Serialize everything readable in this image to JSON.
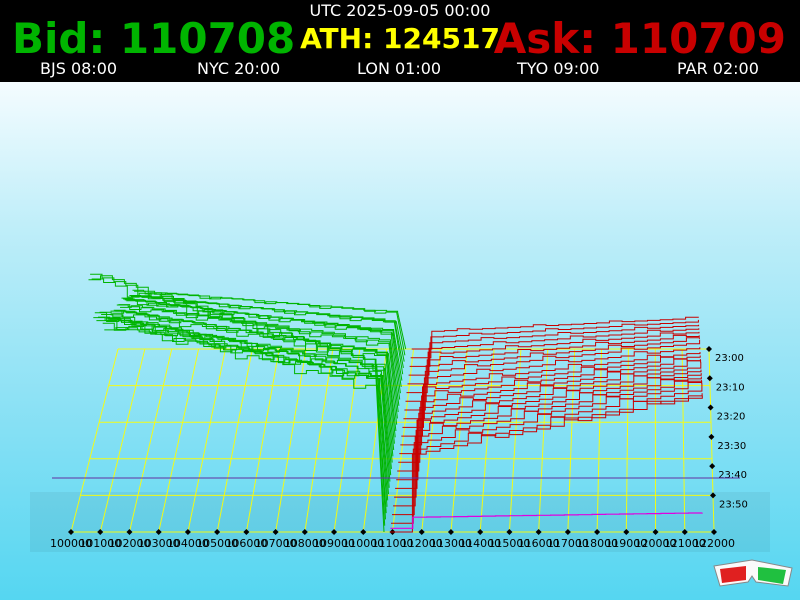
{
  "header": {
    "utc": "UTC 2025-09-05 00:00",
    "bid_label": "Bid: 110708",
    "ath_label": "ATH: 124517",
    "ask_label": "Ask: 110709",
    "zones": [
      "BJS 08:00",
      "NYC 20:00",
      "LON 01:00",
      "TYO 09:00",
      "PAR 02:00"
    ]
  },
  "colors": {
    "bid": "#00b400",
    "ask": "#c80000",
    "ath": "#ffff00",
    "grid": "#ffff00",
    "latest_ask": "#e000e0"
  },
  "icons": {
    "glasses": "3d-glasses-icon"
  },
  "chart_data": {
    "type": "depth-3d",
    "x": {
      "ticks": [
        100000,
        101000,
        102000,
        103000,
        104000,
        105000,
        106000,
        107000,
        108000,
        109000,
        110000,
        111000,
        112000,
        113000,
        114000,
        115000,
        116000,
        117000,
        118000,
        119000,
        120000,
        121000,
        122000
      ],
      "range": [
        100000,
        122000
      ]
    },
    "time_ticks": [
      "23:00",
      "23:10",
      "23:20",
      "23:30",
      "23:40",
      "23:50"
    ],
    "mid_price": 110708,
    "bid_depth_levels": [
      2.0,
      1.95,
      1.88,
      1.55,
      1.5,
      1.45,
      1.4,
      1.35,
      1.3,
      1.2,
      1.15,
      1.12,
      1.08,
      1.05,
      1.02,
      1.0,
      0.96,
      0.92,
      0.88,
      0.85,
      0.82,
      0.78,
      0.74,
      0.7,
      0.66,
      0.62,
      0.58,
      0.54,
      0.5,
      0.46
    ],
    "ask_depth_levels": [
      1.05,
      1.0,
      0.97,
      0.94,
      0.9,
      0.86,
      0.82,
      0.78,
      0.74,
      0.7,
      0.66,
      0.62,
      0.58,
      0.55,
      0.52,
      0.48,
      0.44,
      0.4,
      0.36,
      0.32,
      0.28,
      0.24
    ],
    "grid": true
  }
}
